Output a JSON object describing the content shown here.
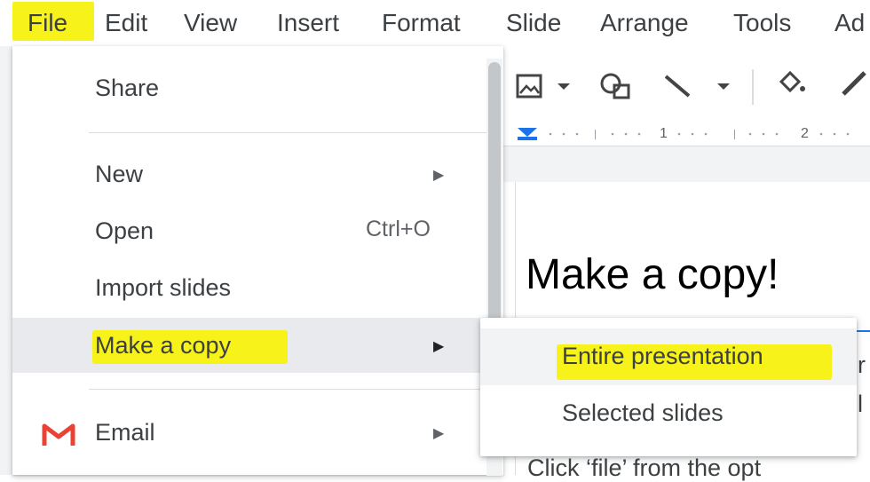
{
  "menubar": {
    "items": [
      "File",
      "Edit",
      "View",
      "Insert",
      "Format",
      "Slide",
      "Arrange",
      "Tools",
      "Ad"
    ]
  },
  "file_menu": {
    "share": "Share",
    "new": "New",
    "open": "Open",
    "open_shortcut": "Ctrl+O",
    "import": "Import slides",
    "make_copy": "Make a copy",
    "email": "Email"
  },
  "submenu": {
    "entire": "Entire presentation",
    "selected": "Selected slides"
  },
  "ruler": {
    "n1": "1",
    "n2": "2"
  },
  "slide": {
    "title": "Make a copy!",
    "body": "Click ‘file’ from the opt"
  },
  "colors": {
    "highlight": "#f6f21a",
    "gmail_red": "#ea4335",
    "ruler_blue": "#1a73e8"
  }
}
